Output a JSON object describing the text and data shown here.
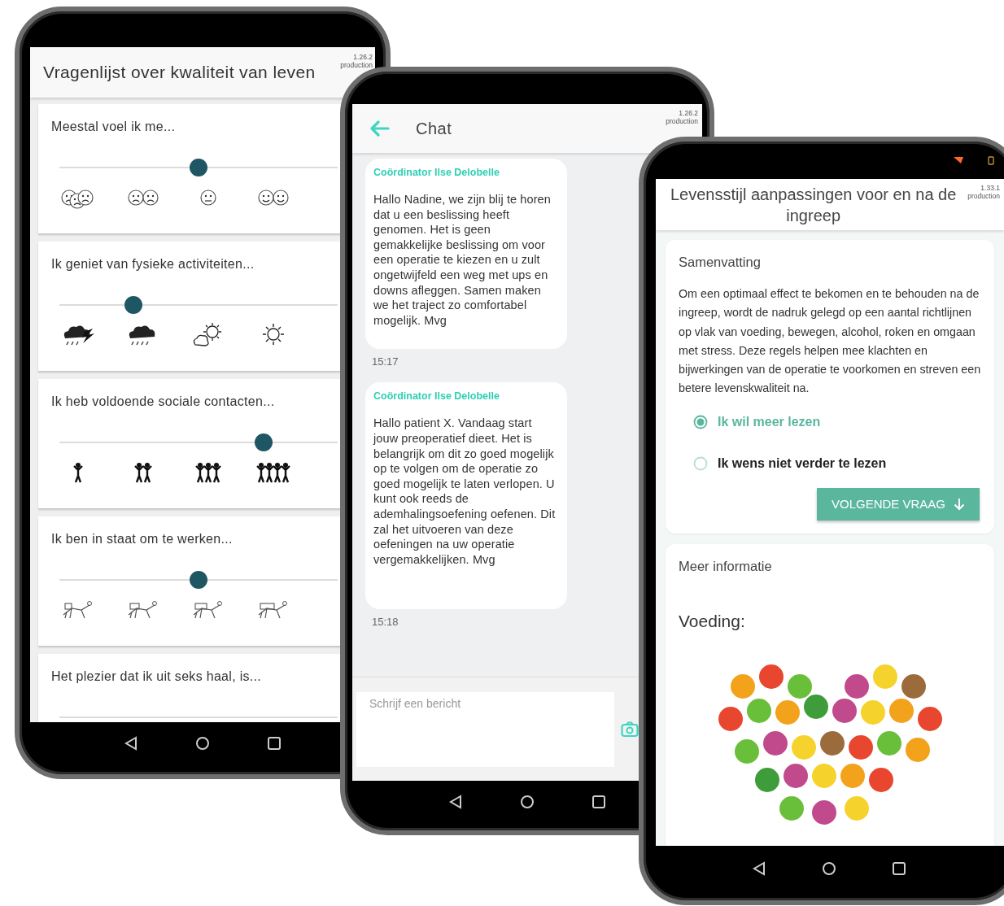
{
  "phones": [
    {
      "kind": "questionnaire",
      "title": "Vragenlijst over kwaliteit van leven",
      "version": "1.26.2",
      "build": "production",
      "questions": [
        {
          "text": "Meestal voel ik me...",
          "kind": "mood",
          "level": 0.5
        },
        {
          "text": "Ik geniet van fysieke activiteiten...",
          "kind": "weather",
          "level": 0.25
        },
        {
          "text": "Ik heb voldoende sociale contacten...",
          "kind": "people",
          "level": 0.75
        },
        {
          "text": "Ik ben in staat om te werken...",
          "kind": "work",
          "level": 0.5
        },
        {
          "text": "Het plezier dat ik uit seks haal, is..."
        }
      ]
    },
    {
      "kind": "chat",
      "title": "Chat",
      "version": "1.26.2",
      "build": "production",
      "messages": [
        {
          "sender": "Coördinator Ilse Delobelle",
          "text": "Hallo Nadine, we zijn blij te horen dat u een beslissing heeft genomen. Het is geen gemakkelijke beslissing om voor een operatie te kiezen en u zult ongetwijfeld een weg met ups en downs afleggen. Samen maken we het traject zo comfortabel mogelijk. Mvg",
          "time": "15:17"
        },
        {
          "sender": "Coördinator Ilse Delobelle",
          "text": "Hallo patient X. Vandaag start jouw preoperatief dieet. Het is belangrijk om dit zo goed mogelijk op te volgen om de operatie zo goed mogelijk te laten verlopen. U kunt ook reeds de ademhalingsoefening oefenen. Dit zal het uitvoeren van deze oefeningen na uw operatie vergemakkelijken. Mvg",
          "time": "15:18"
        }
      ],
      "input": {
        "placeholder": "Schrijf een bericht"
      }
    },
    {
      "kind": "article",
      "title": "Levensstijl aanpassingen voor en na de ingreep",
      "version": "1.33.1",
      "build": "production",
      "summary": {
        "heading": "Samenvatting",
        "text": "Om een optimaal effect te bekomen en te behouden na de ingreep, wordt de nadruk gelegd op een aantal richtlijnen op vlak van voeding, bewegen, alcohol, roken en omgaan met stress. Deze regels helpen mee klachten en bijwerkingen van de operatie te voorkomen en streven een betere levenskwaliteit na.",
        "options": [
          {
            "label": "Ik wil meer lezen",
            "selected": true
          },
          {
            "label": "Ik wens niet verder te lezen",
            "selected": false
          }
        ],
        "button": "VOLGENDE VRAAG"
      },
      "more": {
        "heading": "Meer informatie",
        "subheading": "Voeding:"
      }
    }
  ]
}
